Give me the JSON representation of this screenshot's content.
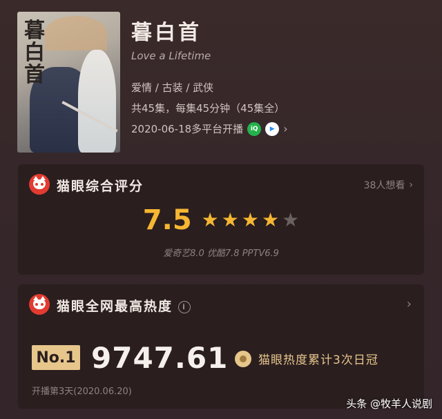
{
  "show": {
    "title": "暮白首",
    "subtitle": "Love a Lifetime",
    "genres": "爱情 / 古装 / 武侠",
    "episodes": "共45集，每集45分钟（45集全）",
    "premiere": "2020-06-18多平台开播",
    "platforms": [
      "iqiyi-icon",
      "tencent-video-icon"
    ]
  },
  "rating_card": {
    "title": "猫眼综合评分",
    "want_to_see": "38人想看",
    "score": "7.5",
    "stars": {
      "full": 4,
      "empty": 1
    },
    "sub_scores": "爱奇艺8.0  优酷7.8  PPTV6.9"
  },
  "heat_card": {
    "title": "猫眼全网最高热度",
    "rank": "No.1",
    "heat_value": "9747.61",
    "medal_text": "猫眼热度累计3次日冠",
    "open_day": "开播第3天(2020.06.20)"
  },
  "watermark": "头条 @牧羊人说剧",
  "colors": {
    "accent": "#f6b632",
    "gold": "#e7c68c",
    "maoyan_red": "#e23b31"
  }
}
